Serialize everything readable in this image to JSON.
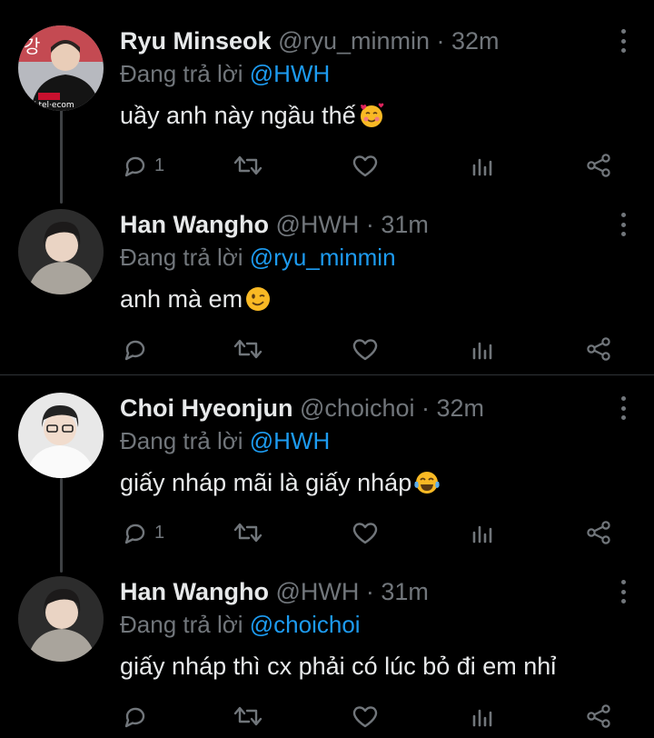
{
  "tweets": [
    {
      "name": "Ryu Minseok",
      "handle": "@ryu_minmin",
      "time": "· 32m",
      "reply_prefix": "Đang trả lời ",
      "reply_to": "@HWH",
      "text": "uầy anh này ngầu thế",
      "emoji": "smiling-face-with-hearts",
      "reply_count": "1"
    },
    {
      "name": "Han Wangho",
      "handle": "@HWH",
      "time": "· 31m",
      "reply_prefix": "Đang trả lời ",
      "reply_to": "@ryu_minmin",
      "text": "anh mà em",
      "emoji": "winking-face",
      "reply_count": ""
    },
    {
      "name": "Choi Hyeonjun",
      "handle": "@choichoi",
      "time": "· 32m",
      "reply_prefix": "Đang trả lời ",
      "reply_to": "@HWH",
      "text": "giấy nháp mãi là giấy nháp",
      "emoji": "face-with-tears-of-joy",
      "reply_count": "1"
    },
    {
      "name": "Han Wangho",
      "handle": "@HWH",
      "time": "· 31m",
      "reply_prefix": "Đang trả lời ",
      "reply_to": "@choichoi",
      "text": "giấy nháp thì cx phải có lúc bỏ đi em nhỉ",
      "emoji": "",
      "reply_count": ""
    }
  ],
  "colors": {
    "background": "#000000",
    "text": "#e7e9ea",
    "secondary": "#71767b",
    "mention": "#1d9bf0",
    "divider": "#2f3336"
  },
  "icons": [
    "reply-icon",
    "retweet-icon",
    "like-icon",
    "views-icon",
    "share-icon",
    "more-icon"
  ]
}
